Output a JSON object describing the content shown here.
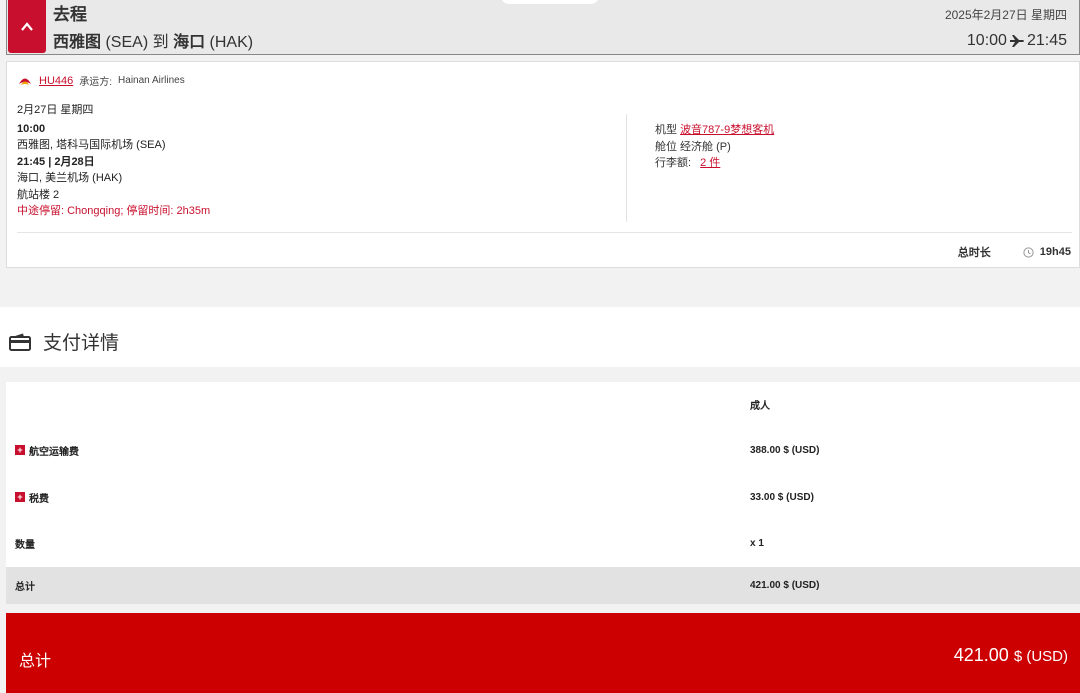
{
  "header": {
    "label": "去程",
    "origin_city": "西雅图",
    "origin_code": "(SEA)",
    "connector": "到",
    "dest_city": "海口",
    "dest_code": "(HAK)",
    "date": "2025年2月27日 星期四",
    "depart_time": "10:00",
    "arrive_time": "21:45"
  },
  "flight": {
    "number": "HU446",
    "carrier_label": "承运方:",
    "carrier": "Hainan Airlines",
    "date": "2月27日 星期四",
    "depart_time": "10:00",
    "depart_airport": "西雅图, 塔科马国际机场 (SEA)",
    "arrive_time": "21:45 | 2月28日",
    "arrive_airport": "海口, 美兰机场 (HAK)",
    "terminal": "航站楼 2",
    "stopover": "中途停留: Chongqing; 停留时间: 2h35m",
    "aircraft_label": "机型",
    "aircraft": "波音787-9梦想客机",
    "cabin": "舱位 经济舱 (P)",
    "baggage_label": "行李额:",
    "baggage": "2 件",
    "duration_label": "总时长",
    "duration": "19h45"
  },
  "payment": {
    "title": "支付详情",
    "passenger_type": "成人",
    "rows": [
      {
        "label": "航空运输费",
        "value": "388.00 $ (USD)"
      },
      {
        "label": "税费",
        "value": "33.00 $ (USD)"
      },
      {
        "label": "数量",
        "value": "x 1"
      },
      {
        "label": "总计",
        "value": "421.00 $ (USD)"
      }
    ],
    "grand_label": "总计",
    "grand_amount": "421.00",
    "grand_currency": "$ (USD)"
  },
  "colors": {
    "brand": "#cc0000",
    "accent": "#c8102e"
  }
}
